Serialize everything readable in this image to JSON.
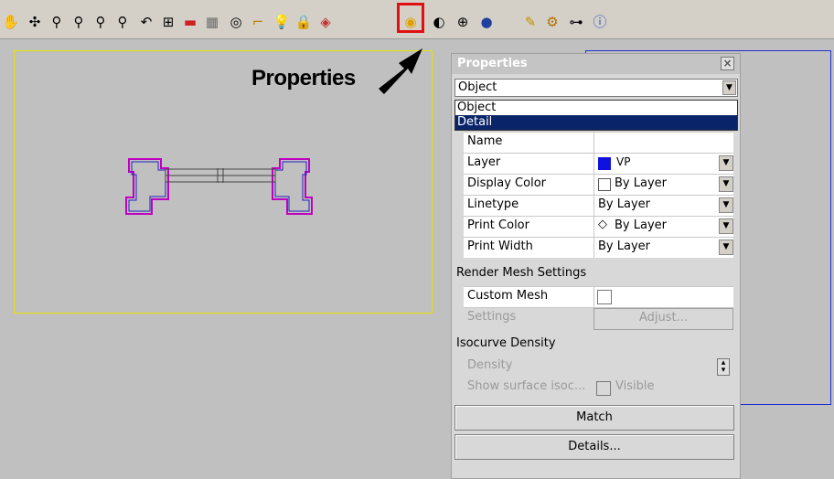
{
  "toolbar": {
    "icons": [
      "pan-icon",
      "rotate-view-icon",
      "zoom-icon",
      "zoom-window-icon",
      "zoom-extents-icon",
      "zoom-selected-icon",
      "undo-view-icon",
      "viewport-layout-icon",
      "car-icon",
      "grid-icon",
      "target-icon",
      "snap-icon",
      "light-bulb-icon",
      "lock-icon",
      "layer-icon",
      "properties-icon",
      "sphere-icon",
      "mesh-icon",
      "render-icon",
      "paint-icon",
      "gear-icon",
      "options-icon",
      "help-icon"
    ],
    "highlight_color": "#e01010"
  },
  "annotation": {
    "text": "Properties"
  },
  "panel": {
    "title": "Properties",
    "select_value": "Object",
    "dropdown_items": [
      "Object",
      "Detail"
    ],
    "selected_dropdown": "Detail",
    "rows": [
      {
        "label": "Name",
        "value": ""
      },
      {
        "label": "Layer",
        "value": "VP"
      },
      {
        "label": "Display Color",
        "value": "By Layer"
      },
      {
        "label": "Linetype",
        "value": "By Layer"
      },
      {
        "label": "Print Color",
        "value": "By Layer"
      },
      {
        "label": "Print Width",
        "value": "By Layer"
      }
    ],
    "render_mesh_title": "Render Mesh Settings",
    "custom_mesh_label": "Custom Mesh",
    "settings_label": "Settings",
    "adjust_label": "Adjust...",
    "isocurve_title": "Isocurve Density",
    "density_label": "Density",
    "show_surface_label": "Show surface isoc...",
    "visible_label": "Visible",
    "match_label": "Match",
    "details_label": "Details...",
    "layer_color": "#1010e0"
  }
}
